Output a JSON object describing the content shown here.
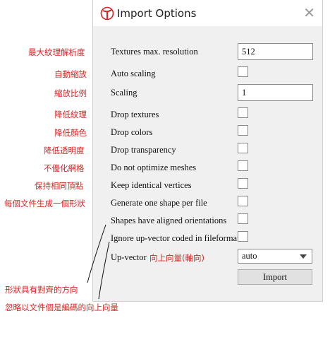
{
  "window": {
    "title": "Import Options",
    "close_glyph": "✕"
  },
  "rows": [
    {
      "label": "Textures max. resolution",
      "control": "text",
      "value": "512"
    },
    {
      "label": "Auto scaling",
      "control": "checkbox",
      "checked": false
    },
    {
      "label": "Scaling",
      "control": "text",
      "value": "1"
    },
    {
      "label": "Drop textures",
      "control": "checkbox",
      "checked": false
    },
    {
      "label": "Drop colors",
      "control": "checkbox",
      "checked": false
    },
    {
      "label": "Drop transparency",
      "control": "checkbox",
      "checked": false
    },
    {
      "label": "Do not optimize meshes",
      "control": "checkbox",
      "checked": false
    },
    {
      "label": "Keep identical vertices",
      "control": "checkbox",
      "checked": false
    },
    {
      "label": "Generate one shape per file",
      "control": "checkbox",
      "checked": false
    },
    {
      "label": "Shapes have aligned orientations",
      "control": "checkbox",
      "checked": false
    },
    {
      "label": "Ignore up-vector coded in fileformat",
      "control": "checkbox",
      "checked": false
    }
  ],
  "up_vector": {
    "label": "Up-vector",
    "value": "auto"
  },
  "import_button": "Import",
  "annotations": {
    "textures_max_resolution": "最大紋理解析度",
    "auto_scaling": "自動縮放",
    "scaling": "縮放比例",
    "drop_textures": "降低紋理",
    "drop_colors": "降低顏色",
    "drop_transparency": "降低透明度",
    "do_not_optimize": "不優化網格",
    "keep_identical_vertices": "保持相同頂點",
    "one_shape_per_file": "每個文件生成一個形狀",
    "up_vector": "向上向量(軸向)",
    "aligned_orientations": "形狀具有對齊的方向",
    "ignore_up_vector": "忽略以文件個是編碼的向上向量"
  },
  "colors": {
    "annotation": "#d42626",
    "dialog_bg": "#f0f0f0",
    "logo": "#d42626"
  },
  "icons": {
    "app": "app-logo-icon",
    "close": "close-icon",
    "dropdown": "chevron-down-icon"
  }
}
